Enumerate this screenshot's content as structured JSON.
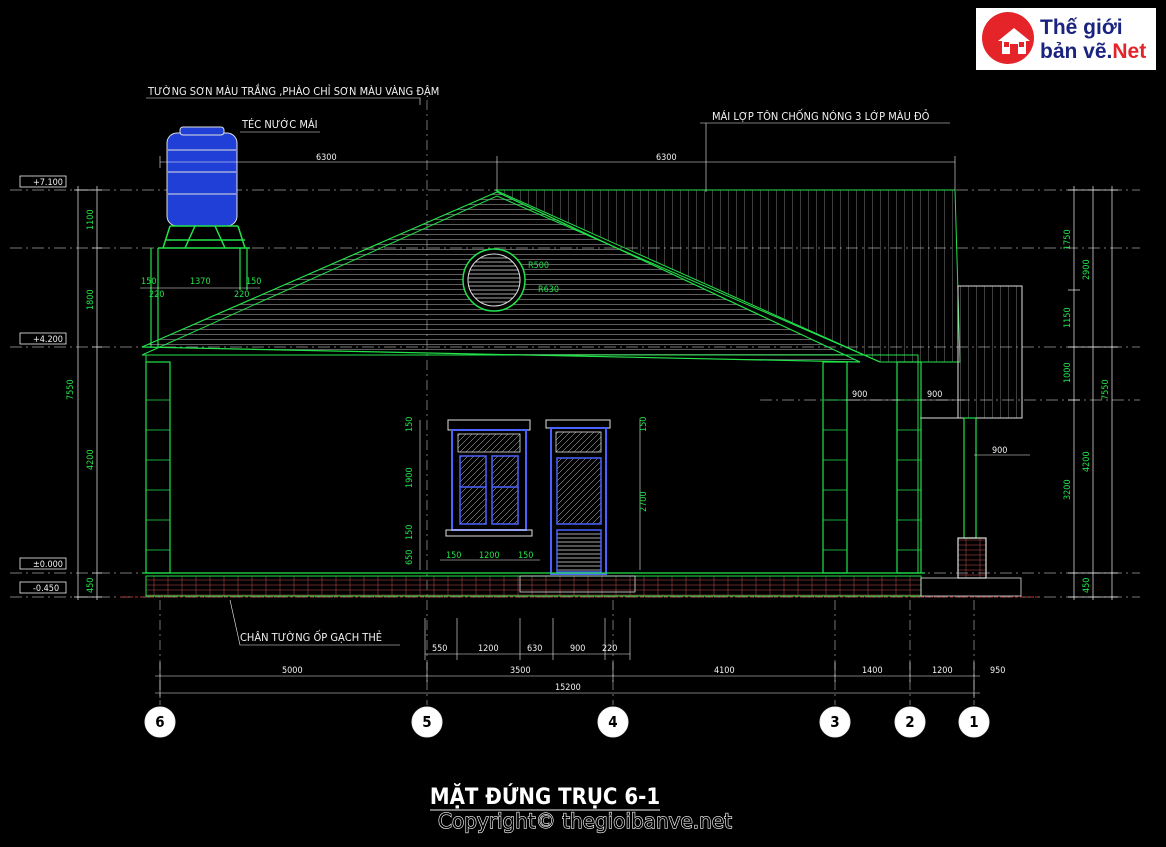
{
  "title": "MẶT ĐỨNG TRỤC 6-1",
  "copyright": "Copyright© thegioibanve.net",
  "logo": {
    "line1": "Thế giới",
    "line2": "bản vẽ.",
    "line2_accent": "Net"
  },
  "notes": {
    "wall_paint": "TƯỜNG SƠN MÀU TRẮNG ,PHÀO CHỈ SƠN MÀU VÀNG ĐẬM",
    "water_tank": "TÉC NƯỚC MÁI",
    "roof": "MÁI LỢP TÔN CHỐNG NÓNG 3 LỚP MÀU ĐỎ",
    "base_tile": "CHÂN TƯỜNG ỐP GẠCH THẺ"
  },
  "levels": [
    "+7.100",
    "+4.200",
    "±0.000",
    "-0.450"
  ],
  "top_dims": [
    "6300",
    "6300"
  ],
  "tank_dims": [
    "150",
    "1370",
    "150",
    "220",
    "220"
  ],
  "vent_labels": [
    "R500",
    "R630"
  ],
  "left_dims": {
    "outer": "7550",
    "inner": [
      "1100",
      "1800",
      "4200",
      "450"
    ]
  },
  "right_dims": {
    "outer": "7550",
    "mid": [
      "2900",
      "4200",
      "450"
    ],
    "inner": [
      "1750",
      "1150",
      "1000",
      "3200"
    ]
  },
  "opening_dims": {
    "window_v": [
      "150",
      "1900",
      "150",
      "650"
    ],
    "door_v": [
      "150",
      "2700"
    ],
    "window_h": [
      "150",
      "1200",
      "150"
    ]
  },
  "porch_dims": [
    "900",
    "900",
    "900"
  ],
  "bottom_dims": {
    "row1": [
      "550",
      "1200",
      "630",
      "900",
      "220"
    ],
    "row2": [
      "5000",
      "3500",
      "4100",
      "1400",
      "1200",
      "950"
    ],
    "total": "15200"
  },
  "axes": [
    "6",
    "5",
    "4",
    "3",
    "2",
    "1"
  ]
}
